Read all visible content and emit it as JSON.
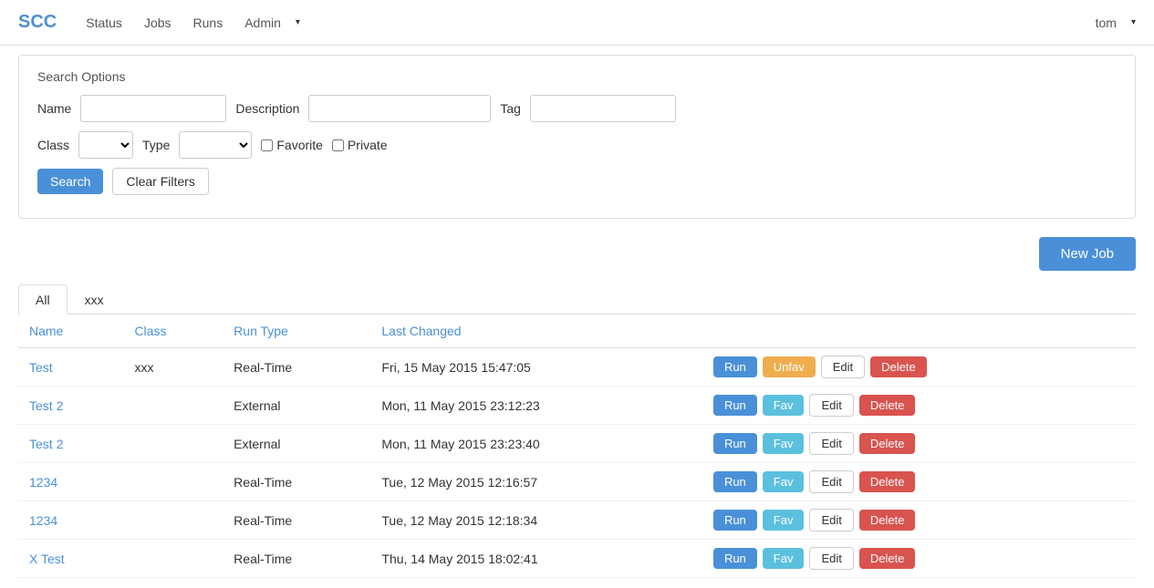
{
  "app": {
    "brand": "SCC",
    "brand_color": "#4a90d9"
  },
  "navbar": {
    "links": [
      {
        "label": "Status",
        "href": "#"
      },
      {
        "label": "Jobs",
        "href": "#"
      },
      {
        "label": "Runs",
        "href": "#"
      },
      {
        "label": "Admin",
        "href": "#",
        "dropdown": true
      },
      {
        "label": "tom",
        "href": "#",
        "dropdown": true
      }
    ]
  },
  "search_panel": {
    "title": "Search Options",
    "name_label": "Name",
    "name_placeholder": "",
    "description_label": "Description",
    "description_placeholder": "",
    "tag_label": "Tag",
    "tag_placeholder": "",
    "class_label": "Class",
    "type_label": "Type",
    "favorite_label": "Favorite",
    "private_label": "Private",
    "search_button": "Search",
    "clear_button": "Clear Filters"
  },
  "new_job_button": "New Job",
  "tabs": [
    {
      "label": "All",
      "active": true
    },
    {
      "label": "xxx",
      "active": false
    }
  ],
  "table": {
    "headers": [
      "Name",
      "Class",
      "Run Type",
      "Last Changed"
    ],
    "rows": [
      {
        "name": "Test",
        "class": "xxx",
        "run_type": "Real-Time",
        "last_changed": "Fri, 15 May 2015 15:47:05",
        "fav_label": "Unfav",
        "fav_type": "unfav"
      },
      {
        "name": "Test 2",
        "class": "",
        "run_type": "External",
        "last_changed": "Mon, 11 May 2015 23:12:23",
        "fav_label": "Fav",
        "fav_type": "fav"
      },
      {
        "name": "Test 2",
        "class": "",
        "run_type": "External",
        "last_changed": "Mon, 11 May 2015 23:23:40",
        "fav_label": "Fav",
        "fav_type": "fav"
      },
      {
        "name": "1234",
        "class": "",
        "run_type": "Real-Time",
        "last_changed": "Tue, 12 May 2015 12:16:57",
        "fav_label": "Fav",
        "fav_type": "fav"
      },
      {
        "name": "1234",
        "class": "",
        "run_type": "Real-Time",
        "last_changed": "Tue, 12 May 2015 12:18:34",
        "fav_label": "Fav",
        "fav_type": "fav"
      },
      {
        "name": "X Test",
        "class": "",
        "run_type": "Real-Time",
        "last_changed": "Thu, 14 May 2015 18:02:41",
        "fav_label": "Fav",
        "fav_type": "fav"
      }
    ],
    "run_label": "Run",
    "edit_label": "Edit",
    "delete_label": "Delete"
  }
}
